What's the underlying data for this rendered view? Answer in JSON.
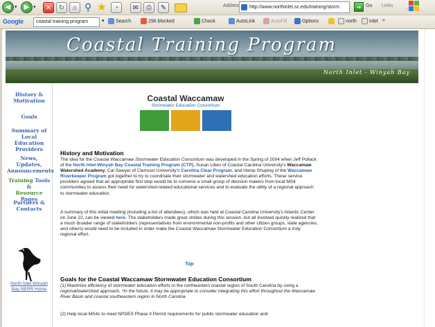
{
  "browser": {
    "address_label": "Address",
    "address_url": "http://www.northinlet.sc.edu/training/storm",
    "go_label": "Go",
    "links_label": "Links",
    "google_logo": "Google",
    "google_query": "coastal training program",
    "toolbar_items": {
      "search": "Search",
      "blocked": "296 blocked",
      "check": "Check",
      "autolink": "AutoLink",
      "autofill": "AutoFill",
      "options": "Options",
      "north": "north",
      "inlet": "inlet"
    }
  },
  "banner": {
    "title": "Coastal Training Program",
    "subtitle": "North Inlet - Winyah Bay"
  },
  "nav": {
    "items": [
      {
        "label_1": "History &",
        "label_2": "Motivation"
      },
      {
        "label_1": "Goals",
        "label_2": ""
      },
      {
        "label_1": "Summary of",
        "label_2": "Local Education",
        "label_3": "Providers"
      },
      {
        "label_1": "News, Updates,",
        "label_2": "Announcements"
      },
      {
        "label_1a": "Training ",
        "label_1b": "Tools &",
        "label_2a": "Resource ",
        "label_2b": "Pages"
      },
      {
        "label_1": "Partners &",
        "label_2": "Contacts"
      }
    ],
    "home_link_1": "North Inlet-Winyah",
    "home_link_2": "Bay NERR Home"
  },
  "logo": {
    "title": "Coastal Waccamaw",
    "subtitle": "Stormwater Education Consortium",
    "colors": [
      "#3f9a3a",
      "#e2a51a",
      "#2f6fb3"
    ]
  },
  "content": {
    "history_heading": "History and Motivation",
    "history_p1": {
      "s1": "The idea for the ",
      "s2": "Coastal Waccamaw Stormwater Education Consortium",
      "s3": " was developed in the Spring of 2004 when Jeff Pollack of the ",
      "s4": "North Inlet-Winyah Bay Coastal Training Program (CTP)",
      "s5": ", Susan Libes of Coastal Carolina University's ",
      "s6": "Waccamaw Watershed Academy",
      "s7": ", Cal Sawyer of Clemson University's ",
      "s8": "Carolina Clear Program",
      "s9": ", and Hamp Shuping of the ",
      "s10": "Waccamaw Riverkeeper Program",
      "s11": " got together to try to coordinate their stormwater and watershed education efforts.  These service providers agreed that an appropriate first step would be to convene a small group of decision makers from local MS4 communities to assess their need for watershed-related educational services and to evaluate the utility of a regional approach to stormwater education."
    },
    "history_p2": {
      "s1": "A summary of this initial meeting (including a list of attendees), which was held at Coastal Carolina University's Atlantic Center on June 22, can be viewed ",
      "s2": "here",
      "s3": ".  The stakeholders made great strides during this session, but all involved quickly realized that a much broader range of stakeholders (representatives from environmental non-profits and other citizen groups, state agencies, and others) would need to be included in order make the Coastal Waccamaw Stormwater Education Consortium a truly regional effort."
    },
    "top_link": "Top",
    "goals_heading": "Goals for the Coastal Waccamaw Stormwater Education Consortium",
    "goals_p1": {
      "s1": "(1) Maximize efficiency of stormwater education efforts in the northeastern coastal region of South Carolina by using a regional/watershed approach.  ",
      "s2": "*In the future, it may be appropriate to consider integrating this effort throughout the Waccamaw River Basin and coastal southeastern region in North Carolina"
    },
    "goals_p2": "(2) Help local MS4s to meet NPDES Phase II Permit requirements for public stormwater education and"
  }
}
